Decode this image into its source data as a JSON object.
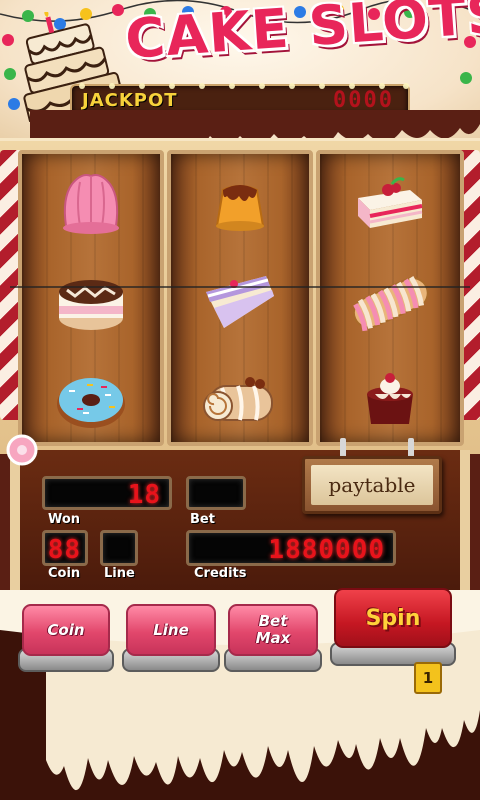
{
  "header": {
    "title": "CAKE SLOTS",
    "jackpot_label": "JACKPOT",
    "jackpot_value": "0000"
  },
  "reels": [
    {
      "symbols": [
        "pink-jelly-icon",
        "chocolate-cake-icon",
        "donut-icon"
      ]
    },
    {
      "symbols": [
        "pudding-icon",
        "cake-slice-icon",
        "swiss-roll-icon"
      ]
    },
    {
      "symbols": [
        "layer-cake-icon",
        "eclair-icon",
        "lava-cake-icon"
      ]
    }
  ],
  "panel": {
    "won_label": "Won",
    "won_value": "18",
    "bet_label": "Bet",
    "bet_value": "",
    "coin_label": "Coin",
    "coin_value": "88",
    "line_label": "Line",
    "line_value": "",
    "credits_label": "Credits",
    "credits_value": "1880000",
    "paytable_label": "paytable"
  },
  "buttons": {
    "coin": "Coin",
    "line": "Line",
    "bet_max_line1": "Bet",
    "bet_max_line2": "Max",
    "spin": "Spin",
    "spin_badge": "1"
  },
  "colors": {
    "title": "#e8265a",
    "jackpot_label": "#f7d23b",
    "lcd_digits": "#e8131b",
    "button_pink": "#e2476c",
    "spin_red": "#c51722"
  }
}
